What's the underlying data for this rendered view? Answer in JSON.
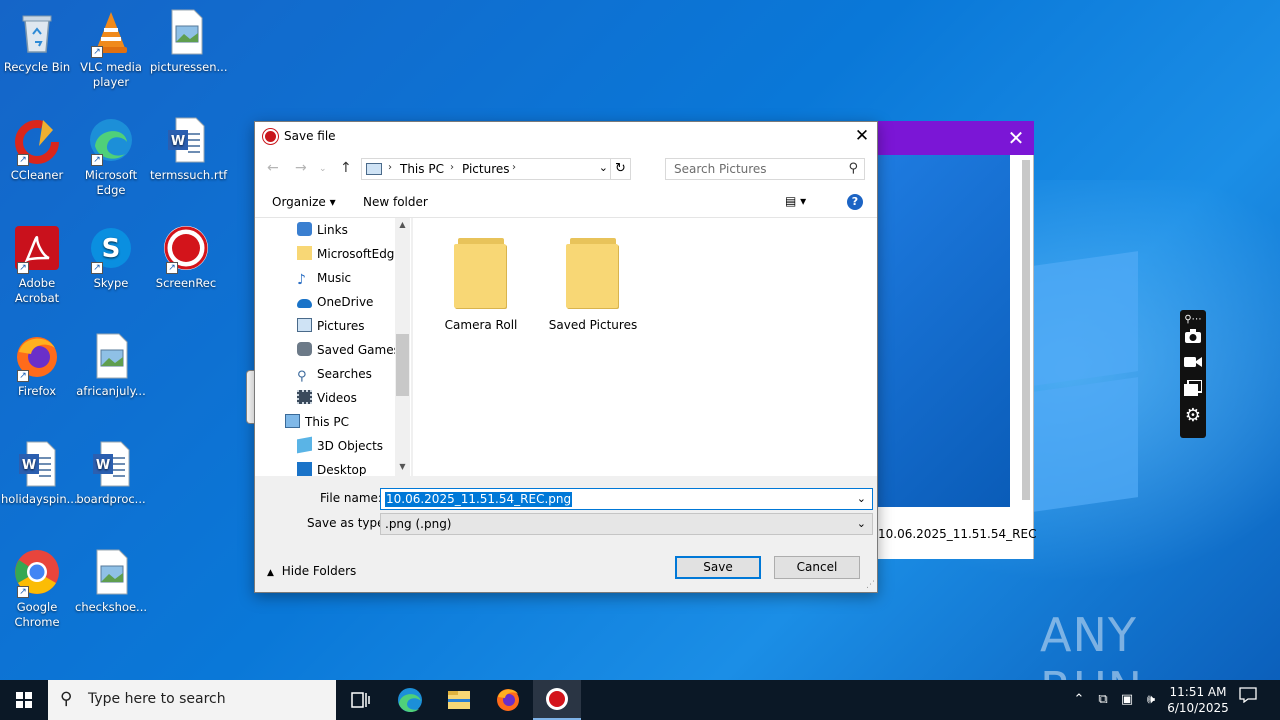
{
  "desktop": {
    "icons": [
      {
        "label": "Recycle Bin"
      },
      {
        "label": "VLC media player"
      },
      {
        "label": "picturessen..."
      },
      {
        "label": "CCleaner"
      },
      {
        "label": "Microsoft Edge"
      },
      {
        "label": "termssuch.rtf"
      },
      {
        "label": "Adobe Acrobat"
      },
      {
        "label": "Skype"
      },
      {
        "label": "ScreenRec"
      },
      {
        "label": "Firefox"
      },
      {
        "label": "africanjuly..."
      },
      {
        "label": "holidayspin..."
      },
      {
        "label": "boardproc..."
      },
      {
        "label": "Google Chrome"
      },
      {
        "label": "checkshoe..."
      }
    ],
    "watermark": "ANY RUN"
  },
  "background_window": {
    "close_glyph": "✕",
    "filename": "10.06.2025_11.51.54_REC",
    "accent": "#7b16d6"
  },
  "dialog": {
    "title": "Save file",
    "close_glyph": "✕",
    "address": {
      "crumbs": [
        "This PC",
        "Pictures"
      ]
    },
    "search_placeholder": "Search Pictures",
    "toolbar": {
      "organize": "Organize ▾",
      "new_folder": "New folder",
      "view_glyph": "▤ ▾",
      "help": "?"
    },
    "nav_items": [
      {
        "label": "Links",
        "icon": "links-icon"
      },
      {
        "label": "MicrosoftEdge",
        "icon": "folder-icon"
      },
      {
        "label": "Music",
        "icon": "music-icon"
      },
      {
        "label": "OneDrive",
        "icon": "onedrive-icon"
      },
      {
        "label": "Pictures",
        "icon": "pictures-icon"
      },
      {
        "label": "Saved Games",
        "icon": "saved-games-icon"
      },
      {
        "label": "Searches",
        "icon": "searches-icon"
      },
      {
        "label": "Videos",
        "icon": "videos-icon"
      },
      {
        "label": "This PC",
        "icon": "this-pc-icon"
      },
      {
        "label": "3D Objects",
        "icon": "3d-objects-icon"
      },
      {
        "label": "Desktop",
        "icon": "desktop-icon"
      }
    ],
    "folders": [
      {
        "label": "Camera Roll"
      },
      {
        "label": "Saved Pictures"
      }
    ],
    "file_name_label": "File name:",
    "file_name_value": "10.06.2025_11.51.54_REC.png",
    "save_type_label": "Save as type:",
    "save_type_value": ".png (.png)",
    "hide_folders": "Hide Folders",
    "save_button": "Save",
    "cancel_button": "Cancel"
  },
  "taskbar": {
    "search_placeholder": "Type here to search",
    "time": "11:51 AM",
    "date": "6/10/2025"
  }
}
